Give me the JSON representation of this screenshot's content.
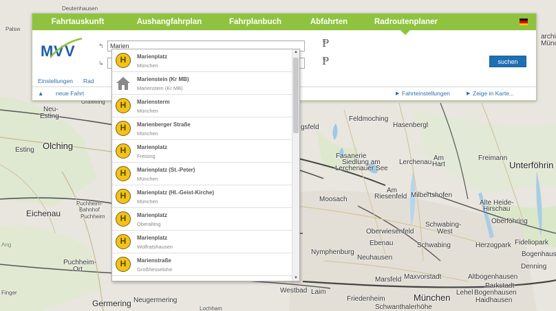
{
  "tabs": [
    {
      "label": "Fahrtauskunft"
    },
    {
      "label": "Aushangfahrplan"
    },
    {
      "label": "Fahrplanbuch"
    },
    {
      "label": "Abfahrten"
    },
    {
      "label": "Radroutenplaner",
      "active": true
    }
  ],
  "form": {
    "from_value": "Marien",
    "to_value": "",
    "search_label": "suchen"
  },
  "links": {
    "settings": "Einstellungen",
    "bike": "Rad",
    "new_trip": "neue Fahrt",
    "trip_settings": "Fahrteinstellungen",
    "show_map": "Zeige in Karte..."
  },
  "suggestions": [
    {
      "name": "Marienplatz",
      "place": "München",
      "icon": "stop-h-icon"
    },
    {
      "name": "Marienstein (Kr MB)",
      "place": "Marienstein (Kr MB)",
      "icon": "house-icon"
    },
    {
      "name": "Mariensterm",
      "place": "München",
      "icon": "stop-h-icon"
    },
    {
      "name": "Marienberger Straße",
      "place": "München",
      "icon": "stop-h-icon"
    },
    {
      "name": "Marienplatz",
      "place": "Freising",
      "icon": "stop-h-icon"
    },
    {
      "name": "Marienplatz (St.-Peter)",
      "place": "München",
      "icon": "stop-h-icon"
    },
    {
      "name": "Marienplatz (Hl.-Geist-Kirche)",
      "place": "München",
      "icon": "stop-h-icon"
    },
    {
      "name": "Marienplatz",
      "place": "Oberalting",
      "icon": "stop-h-icon"
    },
    {
      "name": "Marienplatz",
      "place": "Wolfratshausen",
      "icon": "stop-h-icon"
    },
    {
      "name": "Marienstraße",
      "place": "Großhesselohe",
      "icon": "stop-h-icon"
    }
  ],
  "map_labels": [
    {
      "text": "Deutenhausen"
    },
    {
      "text": "Palsw"
    },
    {
      "text": "archi"
    },
    {
      "text": "Münc"
    },
    {
      "text": "Neu-"
    },
    {
      "text": "Esting"
    },
    {
      "text": "Gräfelfing"
    },
    {
      "text": "Esting"
    },
    {
      "text": "Olching"
    },
    {
      "text": "Eichenau"
    },
    {
      "text": "Puchheim-"
    },
    {
      "text": "Bahnhof"
    },
    {
      "text": "Puchheim"
    },
    {
      "text": "Puchheim-"
    },
    {
      "text": "Ort"
    },
    {
      "text": "Germering"
    },
    {
      "text": "Neugermering"
    },
    {
      "text": "Lochham"
    },
    {
      "text": "Feldmoching"
    },
    {
      "text": "Hasenbergl"
    },
    {
      "text": "gsfeld"
    },
    {
      "text": "Fasanerie"
    },
    {
      "text": "Siedlung am"
    },
    {
      "text": "Lerchenauer See"
    },
    {
      "text": "Lerchenau"
    },
    {
      "text": "Am"
    },
    {
      "text": "Hart"
    },
    {
      "text": "Freimann"
    },
    {
      "text": "Unterföhrin"
    },
    {
      "text": "Am"
    },
    {
      "text": "Riesenfeld"
    },
    {
      "text": "Milbertshofen"
    },
    {
      "text": "Moosach"
    },
    {
      "text": "Alte Heide-"
    },
    {
      "text": "Hirschau"
    },
    {
      "text": "Oberföhring"
    },
    {
      "text": "Oberwiesenfeld"
    },
    {
      "text": "Schwabing-"
    },
    {
      "text": "West"
    },
    {
      "text": "Ebenau"
    },
    {
      "text": "Schwabing"
    },
    {
      "text": "Herzogpark"
    },
    {
      "text": "Fideliopark"
    },
    {
      "text": "Bogenhaus"
    },
    {
      "text": "Nymphenburg"
    },
    {
      "text": "Neuhausen"
    },
    {
      "text": "Denning"
    },
    {
      "text": "Marsfeld"
    },
    {
      "text": "Maxvorstadt"
    },
    {
      "text": "Altbogenhausen"
    },
    {
      "text": "Parkstadt"
    },
    {
      "text": "Bogenhausen"
    },
    {
      "text": "Westbad"
    },
    {
      "text": "Laim"
    },
    {
      "text": "Friedenheim"
    },
    {
      "text": "München"
    },
    {
      "text": "Lehel"
    },
    {
      "text": "Haidhausen"
    },
    {
      "text": "Schwanthalerhöhe"
    },
    {
      "text": "Ang"
    },
    {
      "text": "Finger"
    }
  ]
}
